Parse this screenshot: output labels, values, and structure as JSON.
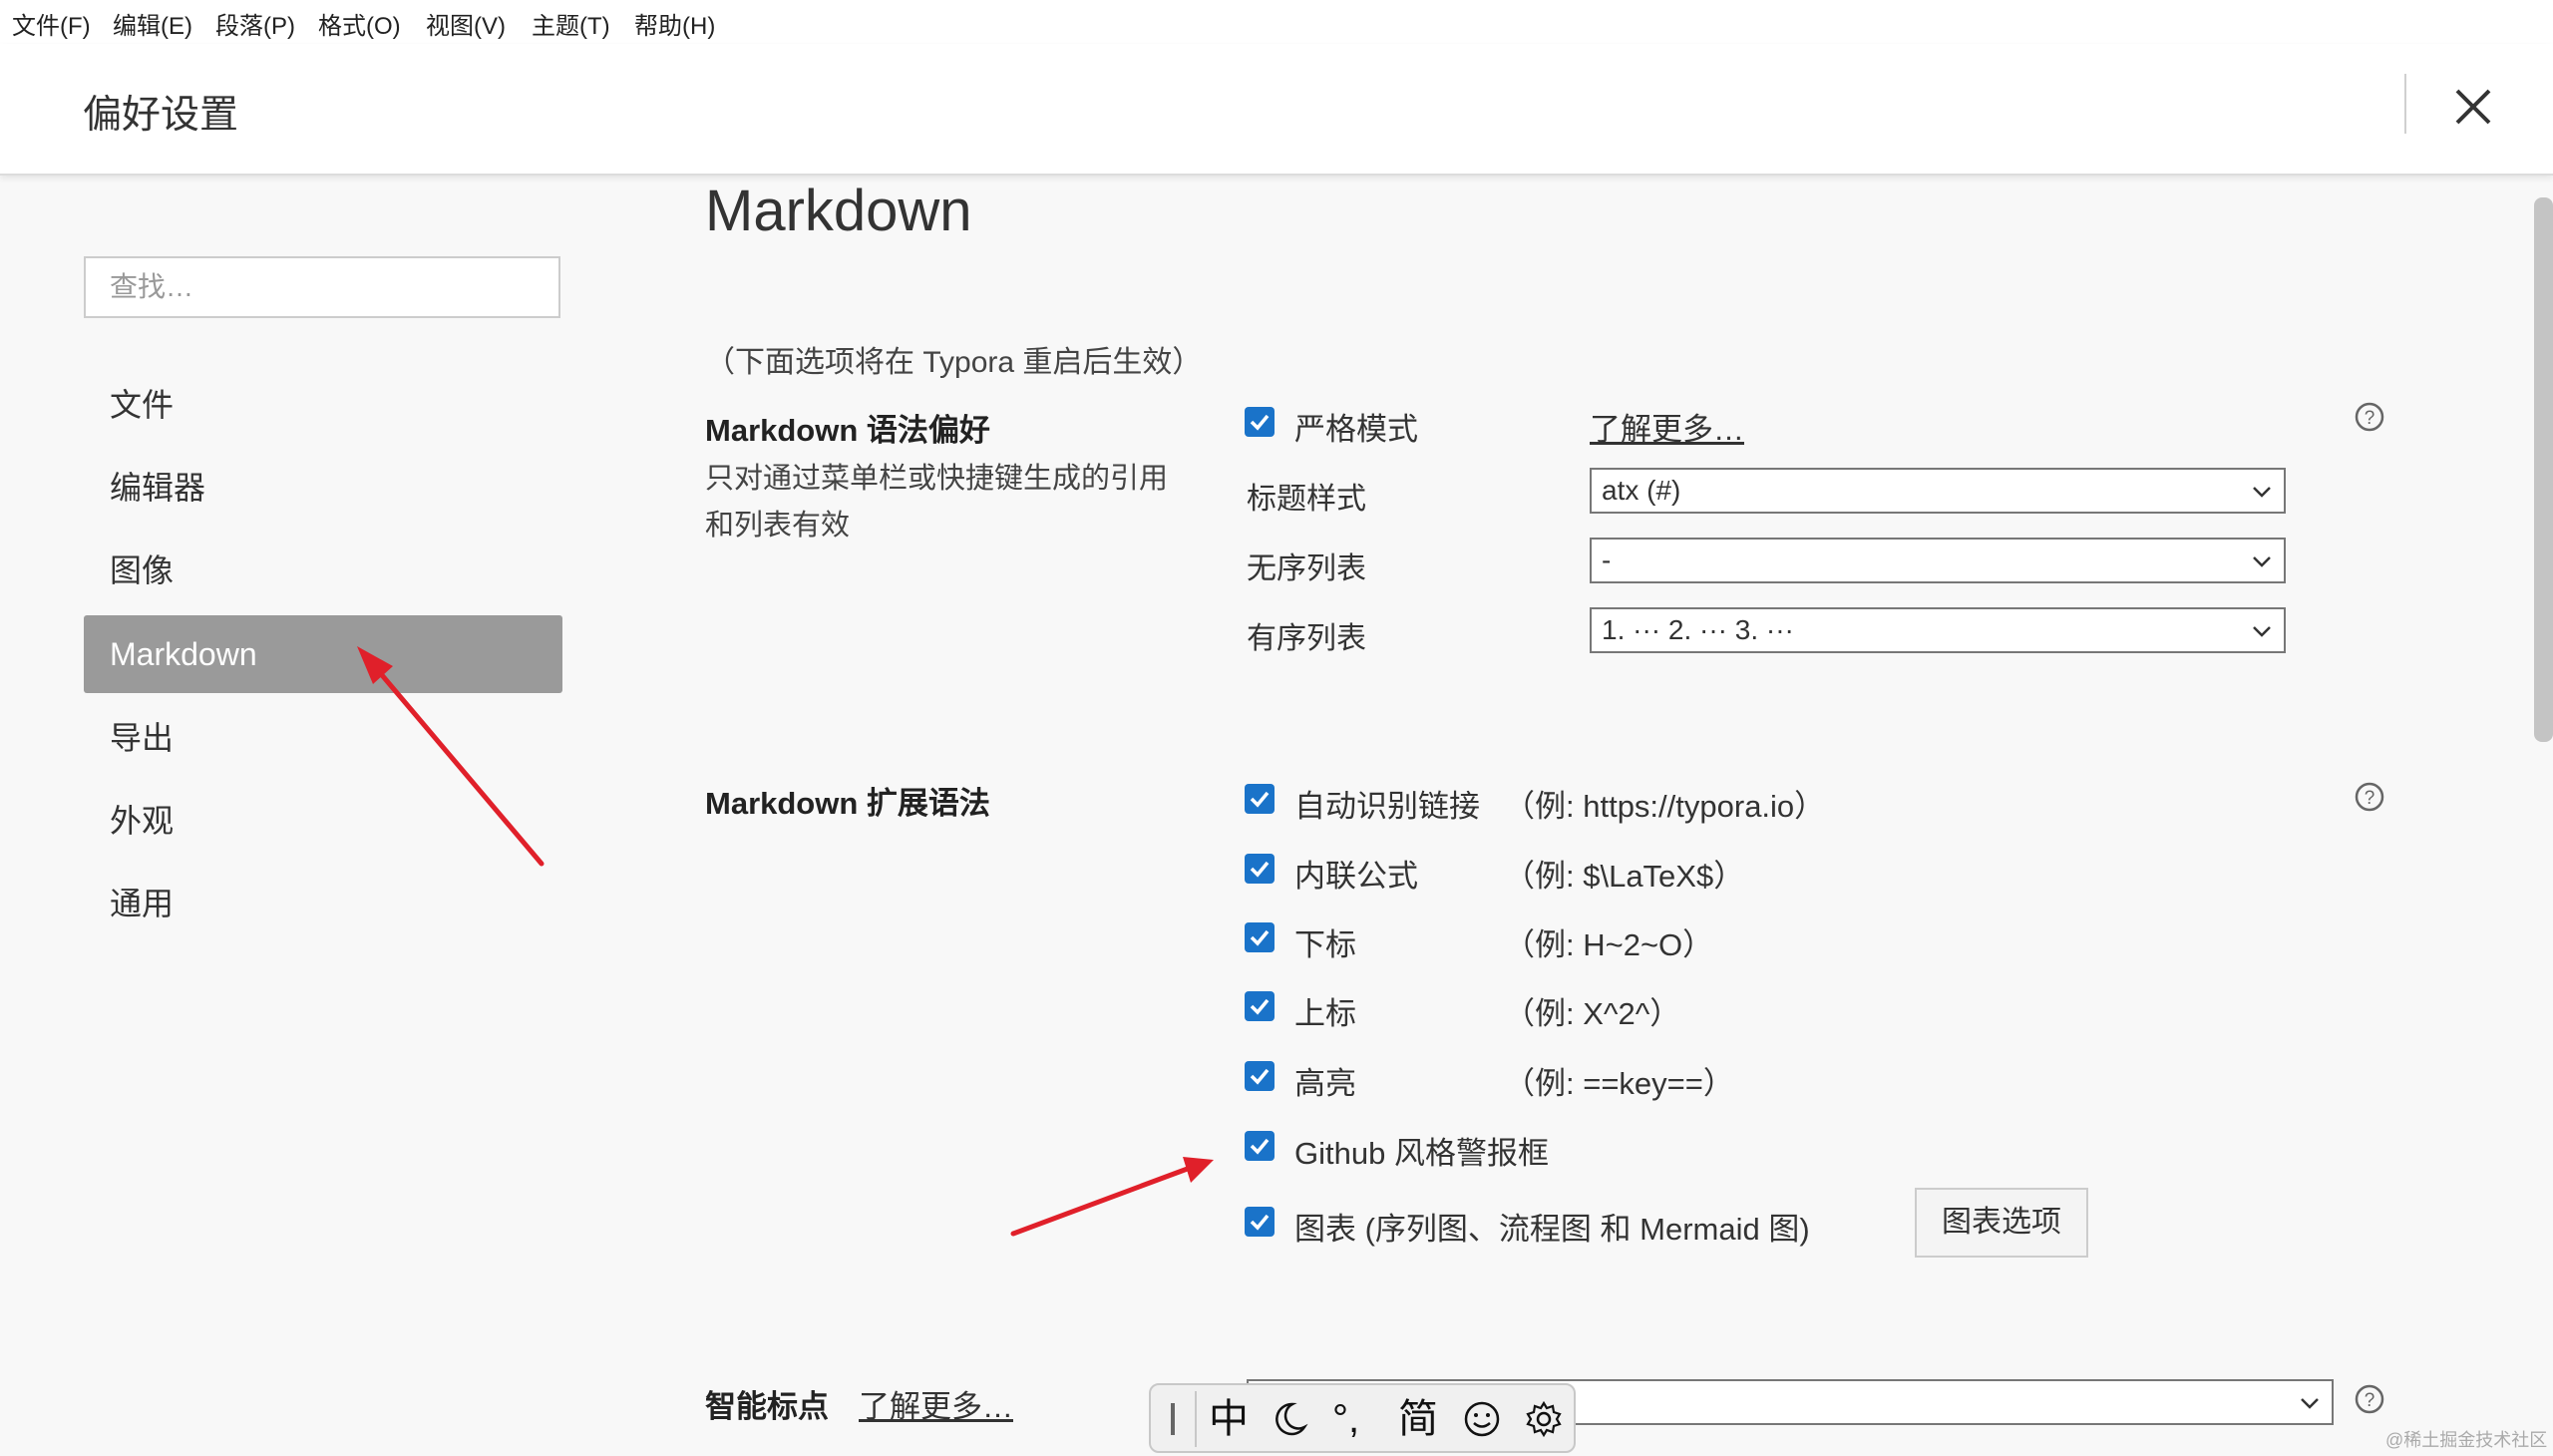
{
  "menubar": {
    "items": [
      "文件(F)",
      "编辑(E)",
      "段落(P)",
      "格式(O)",
      "视图(V)",
      "主题(T)",
      "帮助(H)"
    ]
  },
  "header": {
    "title": "偏好设置",
    "close_icon": "close-icon"
  },
  "sidebar": {
    "search_placeholder": "查找…",
    "items": [
      {
        "label": "文件"
      },
      {
        "label": "编辑器"
      },
      {
        "label": "图像"
      },
      {
        "label": "Markdown"
      },
      {
        "label": "导出"
      },
      {
        "label": "外观"
      },
      {
        "label": "通用"
      }
    ],
    "active": "Markdown"
  },
  "content": {
    "heading": "Markdown",
    "note": "（下面选项将在 Typora 重启后生效）",
    "syntax_pref": {
      "title": "Markdown 语法偏好",
      "desc": "只对通过菜单栏或快捷键生成的引用和列表有效",
      "strict_mode": {
        "label": "严格模式",
        "checked": true
      },
      "learn_more": "了解更多…",
      "heading_style": {
        "label": "标题样式",
        "value": "atx (#)"
      },
      "unordered_list": {
        "label": "无序列表",
        "value": "-"
      },
      "ordered_list": {
        "label": "有序列表",
        "value": "1. ··· 2. ··· 3. ···"
      }
    },
    "extended": {
      "title": "Markdown 扩展语法",
      "items": [
        {
          "label": "自动识别链接",
          "example": "（例: https://typora.io）",
          "checked": true
        },
        {
          "label": "内联公式",
          "example": "（例:  $\\LaTeX$）",
          "checked": true
        },
        {
          "label": "下标",
          "example": "（例:  H~2~O）",
          "checked": true
        },
        {
          "label": "上标",
          "example": "（例:  X^2^）",
          "checked": true
        },
        {
          "label": "高亮",
          "example": "（例:  ==key==）",
          "checked": true
        },
        {
          "label": "Github 风格警报框",
          "example": "",
          "checked": true
        },
        {
          "label": "图表 (序列图、流程图 和 Mermaid 图)",
          "example": "",
          "checked": true
        }
      ],
      "chart_options_button": "图表选项"
    },
    "smart_punct": {
      "title": "智能标点",
      "learn_more": "了解更多…"
    }
  },
  "ime": {
    "glyphs": [
      "中",
      "°,",
      "简"
    ],
    "icons": [
      "moon-icon",
      "smiley-icon",
      "gear-icon"
    ]
  },
  "colors": {
    "checkbox": "#1a73c9",
    "active_sidebar": "#9a9a9a",
    "arrow": "#e0202a"
  },
  "watermark": "@稀土掘金技术社区"
}
